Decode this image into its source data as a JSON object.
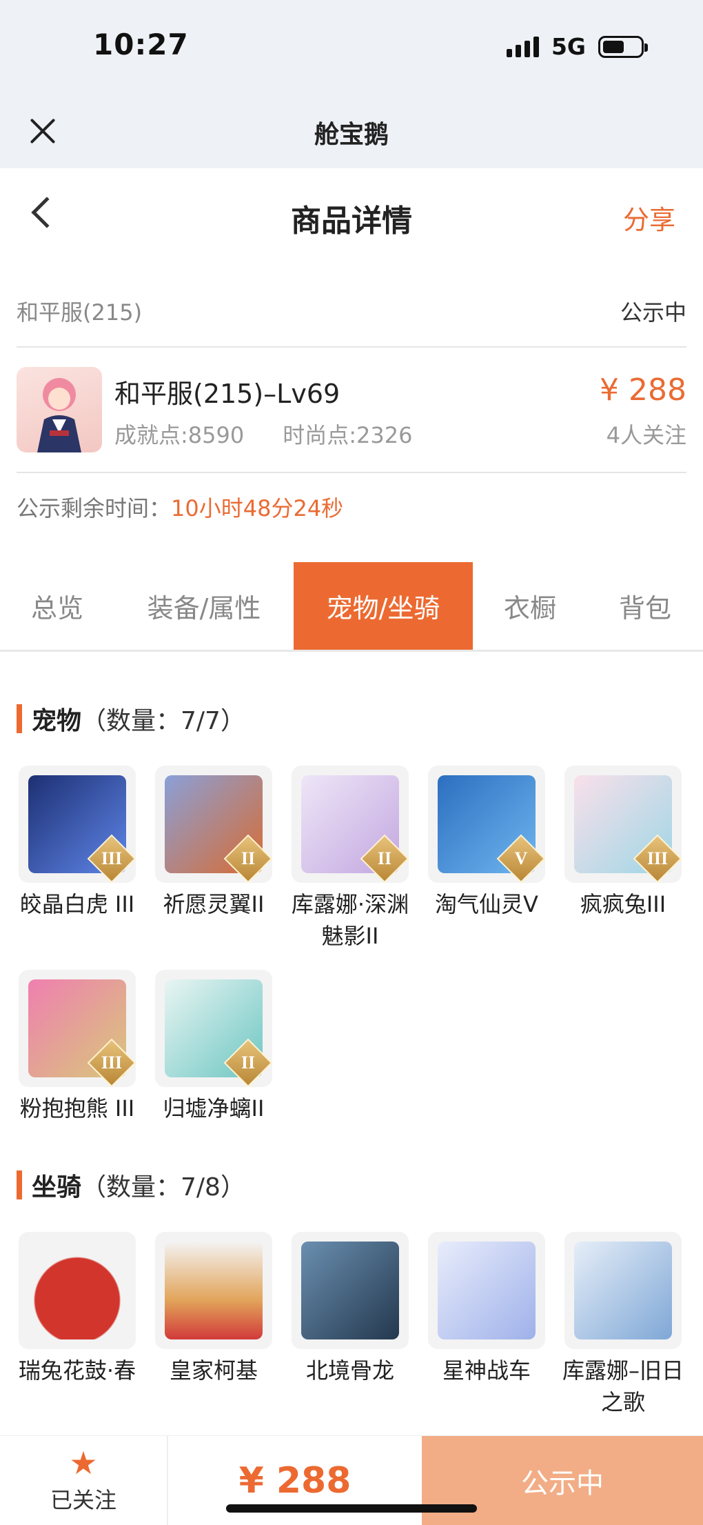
{
  "status_bar": {
    "time": "10:27",
    "network": "5G"
  },
  "mini_program": {
    "title": "舱宝鹅"
  },
  "nav": {
    "title": "商品详情",
    "share": "分享"
  },
  "server": {
    "name": "和平服(215)",
    "status": "公示中"
  },
  "product": {
    "name": "和平服(215)–Lv69",
    "achievement": "成就点:8590",
    "fashion": "时尚点:2326",
    "price": "¥ 288",
    "followers": "4人关注"
  },
  "countdown": {
    "label": "公示剩余时间：",
    "time": "10小时48分24秒"
  },
  "tabs": [
    {
      "label": "总览"
    },
    {
      "label": "装备/属性"
    },
    {
      "label": "宠物/坐骑"
    },
    {
      "label": "衣橱"
    },
    {
      "label": "背包"
    }
  ],
  "pets": {
    "title": "宠物",
    "count": "（数量：7/7）",
    "items": [
      {
        "name": "皎晶白虎 III",
        "grade": "III",
        "color": "#3d63c9"
      },
      {
        "name": "祈愿灵翼II",
        "grade": "II",
        "color": "#c9703d"
      },
      {
        "name": "库露娜·深渊魅影II",
        "grade": "II",
        "color": "#d9c6e8"
      },
      {
        "name": "淘气仙灵V",
        "grade": "V",
        "color": "#3c8ed6"
      },
      {
        "name": "疯疯兔III",
        "grade": "III",
        "color": "#f4c9d6"
      },
      {
        "name": "粉抱抱熊 III",
        "grade": "III",
        "color": "#e77aa8"
      },
      {
        "name": "归墟净螭II",
        "grade": "II",
        "color": "#8fd3d6"
      }
    ]
  },
  "mounts": {
    "title": "坐骑",
    "count": "（数量：7/8）",
    "items": [
      {
        "name": "瑞兔花鼓·春",
        "color": "#d2352c"
      },
      {
        "name": "皇家柯基",
        "color": "#d9954a"
      },
      {
        "name": "北境骨龙",
        "color": "#3e5a78"
      },
      {
        "name": "星神战车",
        "color": "#b9c6ef"
      },
      {
        "name": "库露娜–旧日之歌",
        "color": "#a9c8e8"
      }
    ]
  },
  "bottom_bar": {
    "follow": "已关注",
    "price": "¥ 288",
    "status": "公示中"
  }
}
